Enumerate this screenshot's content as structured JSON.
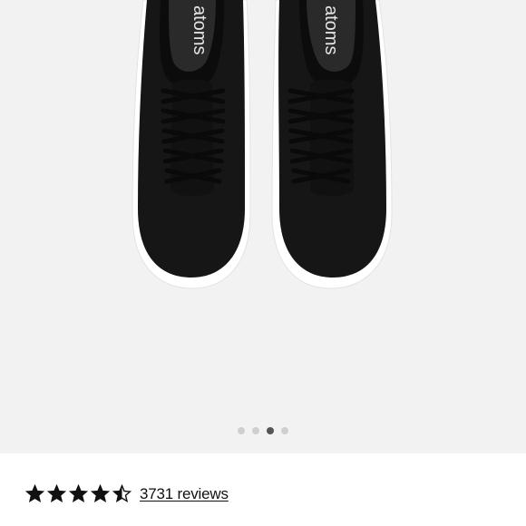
{
  "product": {
    "brand_mark": "atoms"
  },
  "gallery": {
    "slide_count": 4,
    "active_slide": 3
  },
  "rating": {
    "value": 4.5,
    "max": 5,
    "reviews_label": "3731 reviews"
  },
  "colors": {
    "gallery_bg": "#f2f2f2",
    "shoe_upper": "#161616",
    "sole": "#ffffff",
    "dot_inactive": "#cfcfcf",
    "dot_active": "#555555",
    "star": "#111111"
  }
}
